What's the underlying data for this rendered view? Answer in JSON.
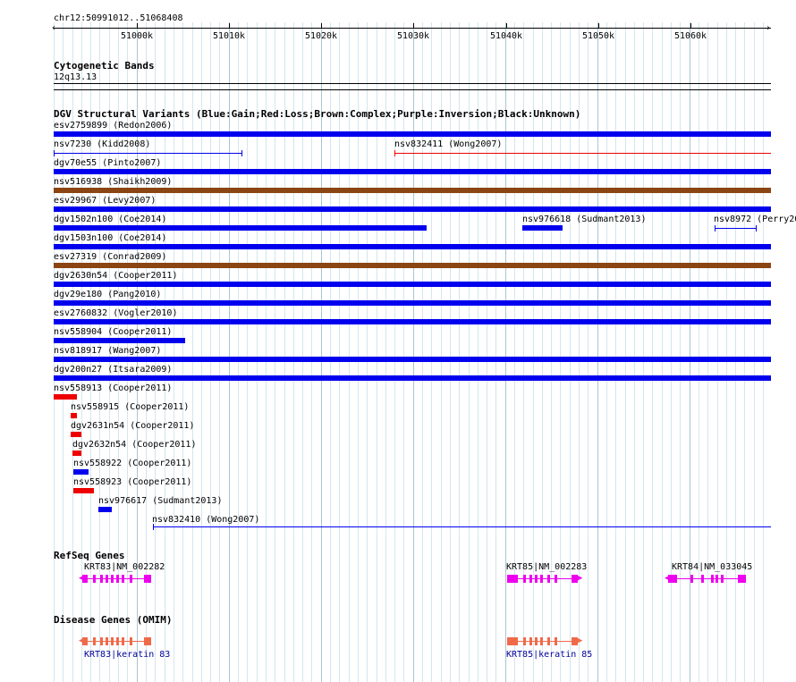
{
  "ruler": {
    "locus": "chr12:50991012..51068408",
    "ticks": [
      "51000k",
      "51010k",
      "51020k",
      "51030k",
      "51040k",
      "51050k",
      "51060k"
    ]
  },
  "tracks": {
    "cytobands": {
      "title": "Cytogenetic Bands",
      "band": "12q13.13"
    },
    "dgv": {
      "title": "DGV Structural Variants (Blue:Gain;Red:Loss;Brown:Complex;Purple:Inversion;Black:Unknown)",
      "variants": [
        "esv2759899 (Redon2006)",
        "nsv7230 (Kidd2008)",
        "nsv832411 (Wong2007)",
        "dgv70e55 (Pinto2007)",
        "nsv516938 (Shaikh2009)",
        "esv29967 (Levy2007)",
        "dgv1502n100 (Coe2014)",
        "nsv976618 (Sudmant2013)",
        "nsv8972 (Perry20",
        "dgv1503n100 (Coe2014)",
        "esv27319 (Conrad2009)",
        "dgv2630n54 (Cooper2011)",
        "dgv29e180 (Pang2010)",
        "esv2760832 (Vogler2010)",
        "nsv558904 (Cooper2011)",
        "nsv818917 (Wang2007)",
        "dgv200n27 (Itsara2009)",
        "nsv558913 (Cooper2011)",
        "nsv558915 (Cooper2011)",
        "dgv2631n54 (Cooper2011)",
        "dgv2632n54 (Cooper2011)",
        "nsv558922 (Cooper2011)",
        "nsv558923 (Cooper2011)",
        "nsv976617 (Sudmant2013)",
        "nsv832410 (Wong2007)"
      ]
    },
    "refseq": {
      "title": "RefSeq Genes",
      "genes": [
        "KRT83|NM_002282",
        "KRT85|NM_002283",
        "KRT84|NM_033045"
      ]
    },
    "omim": {
      "title": "Disease Genes (OMIM)",
      "genes": [
        "KRT83|keratin 83",
        "KRT85|keratin 85"
      ]
    }
  },
  "colors": {
    "gain": "#0000ee",
    "loss": "#ee0000",
    "complex": "#8b4513",
    "refseq": "#ee00ee",
    "omim": "#f06a4a",
    "omim_label": "#000099"
  }
}
